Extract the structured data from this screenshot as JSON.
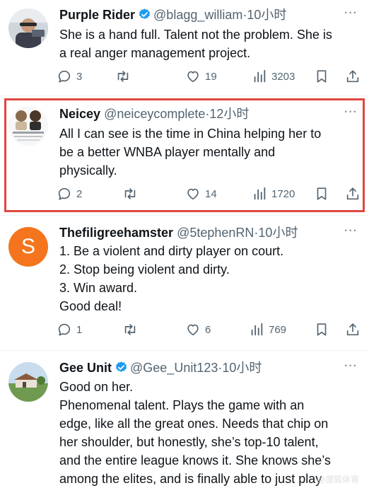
{
  "tweets": [
    {
      "name": "Purple Rider",
      "verified": true,
      "handle": "@blagg_william",
      "separator": "·",
      "time": "10小时",
      "lines": [
        "She is a hand full. Talent not the problem. She is",
        "a real anger management project."
      ],
      "replies": "3",
      "retweets": "",
      "likes": "19",
      "views": "3203"
    },
    {
      "name": "Neicey",
      "verified": false,
      "handle": "@neiceycomplete",
      "separator": "·",
      "time": "12小时",
      "lines": [
        "All I can see is the  time in China helping her to",
        "be a better WNBA player mentally and",
        "physically."
      ],
      "replies": "2",
      "retweets": "",
      "likes": "14",
      "views": "1720"
    },
    {
      "name": "Thefiligreehamster",
      "verified": false,
      "handle": "@5tephenRN",
      "separator": "·",
      "time": "10小时",
      "avatar_letter": "S",
      "lines": [
        "1. Be a violent and dirty player on court.",
        "2. Stop being violent and dirty.",
        "3. Win award.",
        "Good deal!"
      ],
      "replies": "1",
      "retweets": "",
      "likes": "6",
      "views": "769"
    },
    {
      "name": "Gee Unit",
      "verified": true,
      "handle": "@Gee_Unit123",
      "separator": "·",
      "time": "10小时",
      "lines": [
        "Good on her.",
        "Phenomenal talent. Plays the game with an",
        "edge, like all the great ones. Needs that chip on",
        "her shoulder, but honestly, she’s top-10 talent,",
        "and the entire league knows it. She knows she’s",
        "among the elites, and is finally able to just play"
      ]
    }
  ],
  "more_label": "···",
  "watermark": "@搜狐体育",
  "colors": {
    "text": "#0f1419",
    "muted": "#536471",
    "verified": "#1d9bf0",
    "highlight": "#e0473f",
    "avatar_s": "#f4751d"
  },
  "icons": [
    "reply-icon",
    "retweet-icon",
    "like-icon",
    "views-icon",
    "bookmark-icon",
    "share-icon",
    "verified-badge-icon",
    "more-icon"
  ]
}
